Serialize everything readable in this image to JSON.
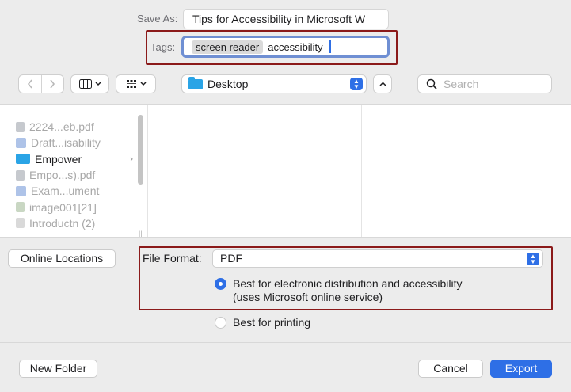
{
  "save_as": {
    "label": "Save As:",
    "value": "Tips for Accessibility in Microsoft W"
  },
  "tags": {
    "label": "Tags:",
    "chips": [
      "screen reader"
    ],
    "typed": "accessibility"
  },
  "toolbar": {
    "back_icon": "chevron-left-icon",
    "forward_icon": "chevron-right-icon",
    "view_icon": "column-view-icon",
    "group_icon": "grid-group-icon",
    "location": "Desktop",
    "search_placeholder": "Search"
  },
  "browser": {
    "items": [
      {
        "name": "2224...eb.pdf",
        "icon": "pdf-icon",
        "enabled": false
      },
      {
        "name": "Draft...isability",
        "icon": "word-doc-icon",
        "enabled": false
      },
      {
        "name": "Empower",
        "icon": "folder-icon",
        "enabled": true,
        "folder": true
      },
      {
        "name": "Empo...s).pdf",
        "icon": "pdf-icon",
        "enabled": false
      },
      {
        "name": "Exam...ument",
        "icon": "word-doc-icon",
        "enabled": false
      },
      {
        "name": "image001[21]",
        "icon": "image-icon",
        "enabled": false
      },
      {
        "name": "Introductn (2)",
        "icon": "doc-icon",
        "enabled": false
      }
    ]
  },
  "online_locations": "Online Locations",
  "file_format": {
    "label": "File Format:",
    "value": "PDF",
    "options": [
      {
        "line1": "Best for electronic distribution and accessibility",
        "line2": "(uses Microsoft online service)",
        "selected": true
      },
      {
        "line1": "Best for printing",
        "line2": "",
        "selected": false
      }
    ]
  },
  "buttons": {
    "new_folder": "New Folder",
    "cancel": "Cancel",
    "export": "Export"
  },
  "colors": {
    "accent": "#2e6fe6",
    "highlight_box": "#8b1a1a",
    "tag_focus": "#6f8fd3"
  }
}
